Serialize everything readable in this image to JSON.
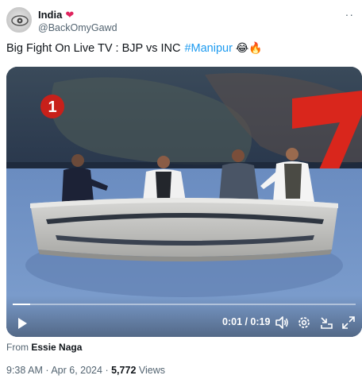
{
  "author": {
    "display_name": "India",
    "verified_emoji": "❤",
    "handle": "@BackOmyGawd",
    "avatar_icon": "eye-logo-icon"
  },
  "more_button": "··",
  "tweet": {
    "text": "Big Fight On Live TV : BJP vs INC",
    "hashtag": "#Manipur",
    "emojis": "😂🔥"
  },
  "video": {
    "channel_logo": "1",
    "time_display": "0:01 / 0:19",
    "progress": 0.05,
    "controls": [
      "play-icon",
      "volume-icon",
      "settings-icon",
      "minimize-icon",
      "fullscreen-icon"
    ]
  },
  "attribution": {
    "prefix": "From",
    "source": "Essie Naga"
  },
  "meta": {
    "time": "9:38 AM",
    "separator1": "·",
    "date": "Apr 6, 2024",
    "separator2": "·",
    "views_count": "5,772",
    "views_label": "Views"
  },
  "colors": {
    "link": "#1d9bf0",
    "secondary_text": "#536471",
    "primary_text": "#0f1419",
    "heart": "#e0245e"
  }
}
